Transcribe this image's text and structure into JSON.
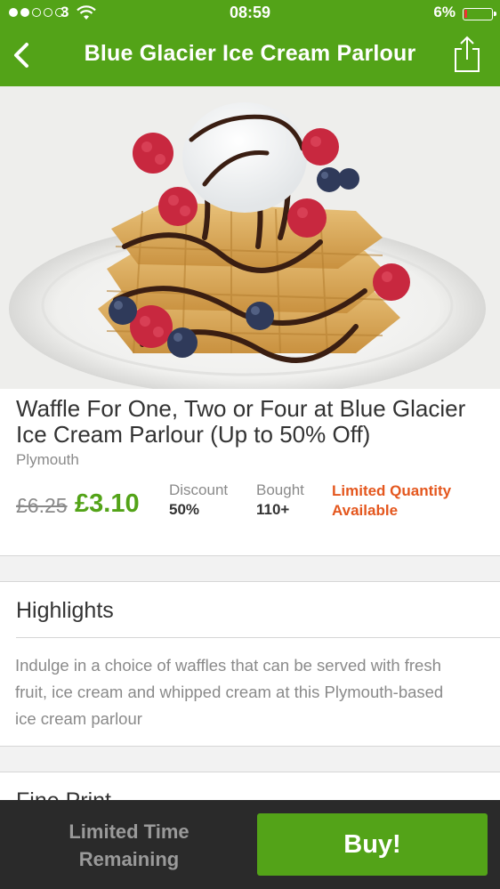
{
  "status_bar": {
    "carrier": "3",
    "time": "08:59",
    "battery": "6%",
    "signal_bars_filled": 2,
    "signal_bars_total": 5
  },
  "nav": {
    "title": "Blue Glacier Ice Cream Parlour",
    "back_icon": "chevron-left-icon",
    "share_icon": "share-icon"
  },
  "hero": {
    "icon": "waffle-ice-cream-photo"
  },
  "deal": {
    "title": "Waffle For One, Two or Four at Blue Glacier Ice Cream Parlour (Up to 50% Off)",
    "location": "Plymouth",
    "price_old": "£6.25",
    "price_new": "£3.10",
    "discount_label": "Discount",
    "discount_value": "50%",
    "bought_label": "Bought",
    "bought_value": "110+",
    "limited_line1": "Limited Quantity",
    "limited_line2": "Available"
  },
  "highlights": {
    "title": "Highlights",
    "text": "Indulge in a choice of waffles that can be served with fresh fruit, ice cream and whipped cream at this Plymouth-based ice cream parlour"
  },
  "fineprint": {
    "title": "Fine Print"
  },
  "bottom_bar": {
    "remaining_line1": "Limited Time",
    "remaining_line2": "Remaining",
    "buy_label": "Buy!"
  },
  "colors": {
    "brand_green": "#53a318",
    "accent_orange": "#e4571e",
    "bottom_bar": "#2a2a2a"
  }
}
